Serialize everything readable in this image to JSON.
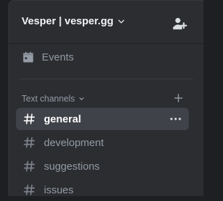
{
  "server": {
    "name": "Vesper | vesper.gg"
  },
  "events": {
    "label": "Events"
  },
  "category": {
    "label": "Text channels"
  },
  "channels": [
    {
      "label": "general",
      "active": true
    },
    {
      "label": "development",
      "active": false
    },
    {
      "label": "suggestions",
      "active": false
    },
    {
      "label": "issues",
      "active": false
    }
  ],
  "colors": {
    "background": "#1e1f22",
    "panel": "#2b2d31",
    "active_channel": "#404249",
    "muted_text": "#949ba4",
    "header_text": "#f2f3f5"
  },
  "icons": {
    "header_dropdown": "chevron-down-icon",
    "invite": "add-member-icon",
    "events": "calendar-icon",
    "category_toggle": "chevron-down-icon",
    "create_channel": "plus-icon",
    "channel": "hash-icon",
    "more": "more-options-icon"
  }
}
